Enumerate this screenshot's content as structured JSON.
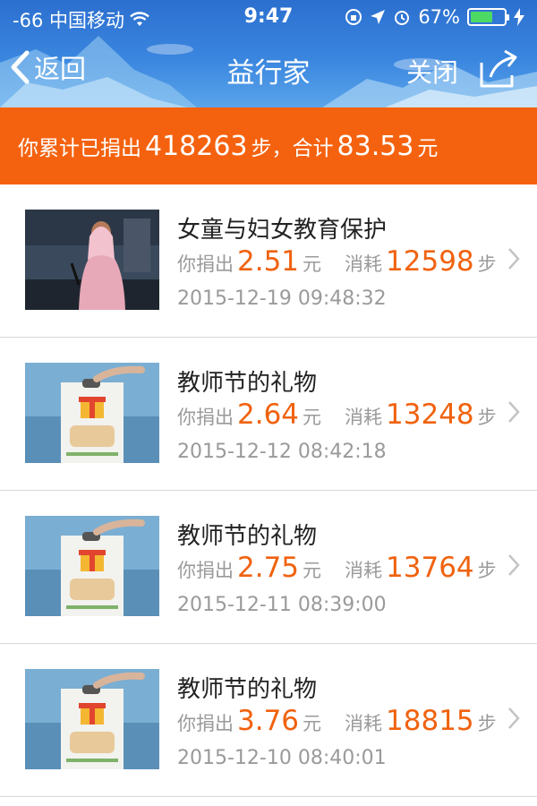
{
  "status_bar": {
    "carrier": "-66 中国移动",
    "time": "9:47",
    "battery": "67%",
    "battery_level": 0.67
  },
  "nav": {
    "back_label": "返回",
    "title": "益行家",
    "close_label": "关闭",
    "share_icon": "share-icon"
  },
  "summary": {
    "prefix": "你累计已捐出",
    "steps": "418263",
    "steps_unit": "步，",
    "total_label": "合计",
    "amount": "83.53",
    "amount_unit": "元"
  },
  "colors": {
    "accent_orange": "#f5620f",
    "header_blue": "#3a86df"
  },
  "list": {
    "items": [
      {
        "name": "女童与妇女教育保护",
        "donate_label": "你捐出",
        "amount": "2.51",
        "amount_unit": "元",
        "consume_label": "消耗",
        "steps": "12598",
        "steps_unit": "步",
        "date": "2015-12-19 09:48:32",
        "thumb": "speaker-photo"
      },
      {
        "name": "教师节的礼物",
        "donate_label": "你捐出",
        "amount": "2.64",
        "amount_unit": "元",
        "consume_label": "消耗",
        "steps": "13248",
        "steps_unit": "步",
        "date": "2015-12-12 08:42:18",
        "thumb": "gift-box-photo"
      },
      {
        "name": "教师节的礼物",
        "donate_label": "你捐出",
        "amount": "2.75",
        "amount_unit": "元",
        "consume_label": "消耗",
        "steps": "13764",
        "steps_unit": "步",
        "date": "2015-12-11 08:39:00",
        "thumb": "gift-box-photo"
      },
      {
        "name": "教师节的礼物",
        "donate_label": "你捐出",
        "amount": "3.76",
        "amount_unit": "元",
        "consume_label": "消耗",
        "steps": "18815",
        "steps_unit": "步",
        "date": "2015-12-10 08:40:01",
        "thumb": "gift-box-photo"
      }
    ]
  }
}
